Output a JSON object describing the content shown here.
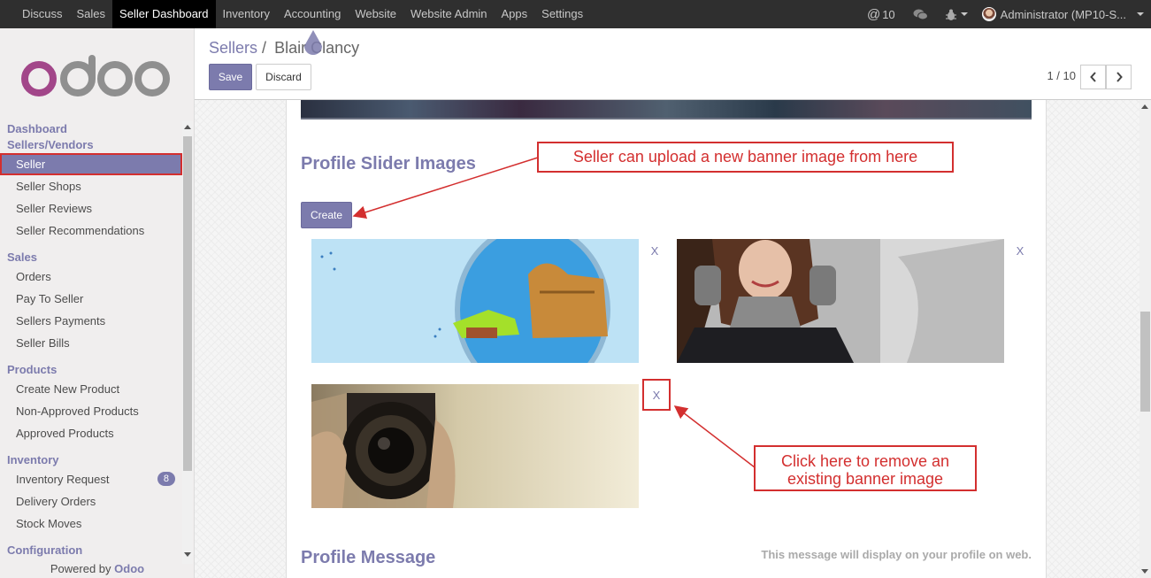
{
  "topbar": {
    "menu": [
      "Discuss",
      "Sales",
      "Seller Dashboard",
      "Inventory",
      "Accounting",
      "Website",
      "Website Admin",
      "Apps",
      "Settings"
    ],
    "active_menu": "Seller Dashboard",
    "mentions_count": "10",
    "user_label": "Administrator (MP10-S..."
  },
  "sidebar": {
    "sections": [
      {
        "title": "Dashboard",
        "items": []
      },
      {
        "title": "Sellers/Vendors",
        "items": [
          {
            "label": "Seller",
            "active": true
          },
          {
            "label": "Seller Shops"
          },
          {
            "label": "Seller Reviews"
          },
          {
            "label": "Seller Recommendations"
          }
        ]
      },
      {
        "title": "Sales",
        "items": [
          {
            "label": "Orders"
          },
          {
            "label": "Pay To Seller"
          },
          {
            "label": "Sellers Payments"
          },
          {
            "label": "Seller Bills"
          }
        ]
      },
      {
        "title": "Products",
        "items": [
          {
            "label": "Create New Product"
          },
          {
            "label": "Non-Approved Products"
          },
          {
            "label": "Approved Products"
          }
        ]
      },
      {
        "title": "Inventory",
        "items": [
          {
            "label": "Inventory Request",
            "badge": "8"
          },
          {
            "label": "Delivery Orders"
          },
          {
            "label": "Stock Moves"
          }
        ]
      },
      {
        "title": "Configuration",
        "items": []
      }
    ],
    "powered_prefix": "Powered by",
    "powered_brand": "Odoo"
  },
  "control": {
    "breadcrumb_parent": "Sellers",
    "breadcrumb_sep": "/",
    "breadcrumb_current": "Blair Clancy",
    "save_label": "Save",
    "discard_label": "Discard",
    "pager": "1 / 10"
  },
  "form": {
    "slider_title": "Profile Slider Images",
    "create_label": "Create",
    "remove_label": "X",
    "message_title": "Profile Message",
    "message_note": "This message will display on your profile on web."
  },
  "callouts": {
    "upload": "Seller can upload a new banner image from here",
    "remove": "Click here to remove an existing banner image"
  },
  "colors": {
    "accent": "#7c7bad",
    "annotation": "#d32f2f",
    "topbar": "#2f2f2f"
  }
}
